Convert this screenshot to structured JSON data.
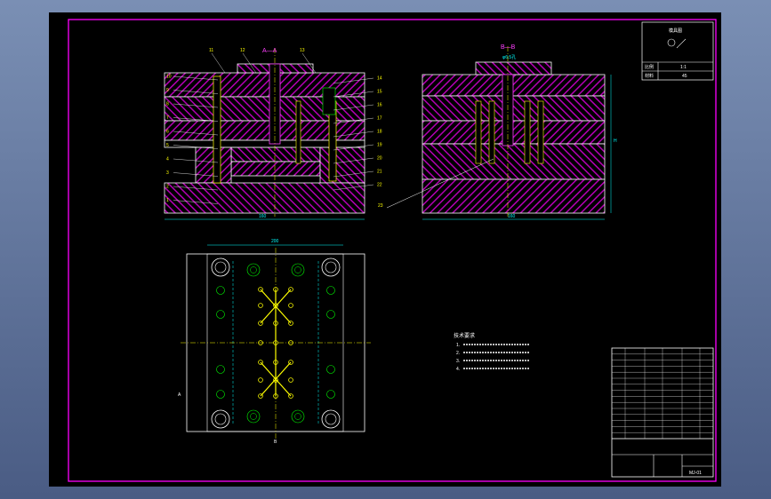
{
  "colors": {
    "frame": "#ff00ff",
    "plate_hatch": "#b400b4",
    "outline": "#ffffff",
    "text": "#ffffff",
    "label": "#ffff00",
    "centerline": "#ffff00",
    "dim": "#00ffff",
    "bolt": "#00ff00",
    "title_magenta": "#ff40ff"
  },
  "section_a": {
    "title": "A—A",
    "top_callouts": [
      "11",
      "12",
      "13"
    ],
    "left_callouts": [
      "10",
      "9",
      "8",
      "7",
      "6",
      "5",
      "4",
      "3",
      "2",
      "1"
    ],
    "right_callouts": [
      "14",
      "15",
      "16",
      "17",
      "18",
      "19",
      "20",
      "21",
      "22"
    ],
    "width_dim": "160"
  },
  "section_b": {
    "title": "B—B",
    "top_dim": "φ6.5孔",
    "bottom_callout": "23",
    "width_dim": "160",
    "right_dim": "H"
  },
  "plan_view": {
    "width_dim": "200",
    "left_marker": "A",
    "bottom_marker": "B"
  },
  "tech_notes": {
    "title": "技术要求",
    "lines": [
      "1.",
      "2.",
      "3.",
      "4."
    ]
  },
  "stamp": {
    "title": "模具图",
    "row1_label": "比例",
    "row1_value": "1:1",
    "row2_label": "材料",
    "row2_value": "45"
  },
  "title_block": {
    "drawing_no": "MJ-01",
    "company": ""
  }
}
